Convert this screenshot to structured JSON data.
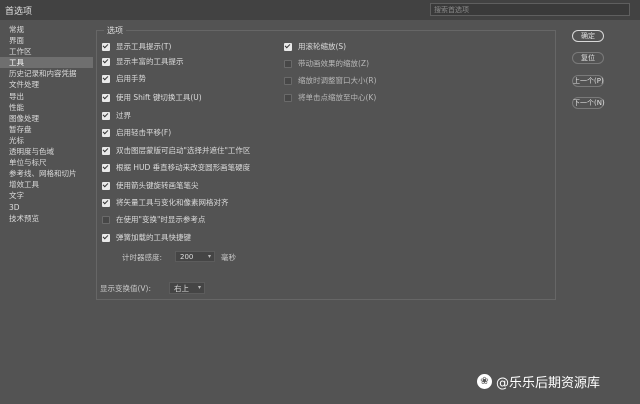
{
  "window": {
    "title": "首选项",
    "search_placeholder": "搜索首选项"
  },
  "sidebar": {
    "items": [
      {
        "label": "常规"
      },
      {
        "label": "界面"
      },
      {
        "label": "工作区"
      },
      {
        "label": "工具",
        "active": true
      },
      {
        "label": "历史记录和内容凭据"
      },
      {
        "label": "文件处理"
      },
      {
        "label": "导出"
      },
      {
        "label": "性能"
      },
      {
        "label": "图像处理"
      },
      {
        "label": "暂存盘"
      },
      {
        "label": "光标"
      },
      {
        "label": "透明度与色域"
      },
      {
        "label": "单位与标尺"
      },
      {
        "label": "参考线、网格和切片"
      },
      {
        "label": "增效工具"
      },
      {
        "label": "文字"
      },
      {
        "label": "3D"
      },
      {
        "label": "技术预览"
      }
    ]
  },
  "options": {
    "group_title": "选项",
    "left": [
      {
        "label": "显示工具提示(T)",
        "checked": true
      },
      {
        "label": "显示丰富的工具提示",
        "checked": true
      },
      {
        "label": "启用手势",
        "checked": true
      },
      {
        "label": "使用 Shift 键切换工具(U)",
        "checked": true
      },
      {
        "label": "过界",
        "checked": true
      },
      {
        "label": "启用轻击平移(F)",
        "checked": true
      },
      {
        "label": "双击图层蒙版可启动\"选择并遮住\"工作区",
        "checked": true
      },
      {
        "label": "根据 HUD 垂直移动来改变圆形画笔硬度",
        "checked": true
      },
      {
        "label": "使用箭头键旋转画笔笔尖",
        "checked": true
      },
      {
        "label": "将矢量工具与变化和像素网格对齐",
        "checked": true
      },
      {
        "label": "在使用\"变换\"时显示参考点",
        "checked": false
      },
      {
        "label": "弹簧加载的工具快捷键",
        "checked": true
      }
    ],
    "right": [
      {
        "label": "用滚轮缩放(S)",
        "checked": true
      },
      {
        "label": "带动画效果的缩放(Z)",
        "checked": false
      },
      {
        "label": "缩放时调整窗口大小(R)",
        "checked": false
      },
      {
        "label": "将单击点缩放至中心(K)",
        "checked": false
      }
    ],
    "timer": {
      "label": "计时器感度:",
      "value": "200",
      "unit": "毫秒"
    },
    "transform": {
      "label": "显示变换值(V):",
      "value": "右上"
    }
  },
  "buttons": {
    "ok": "确定",
    "reset": "复位",
    "prev": "上一个(P)",
    "next": "下一个(N)"
  },
  "watermark": "@乐乐后期资源库"
}
